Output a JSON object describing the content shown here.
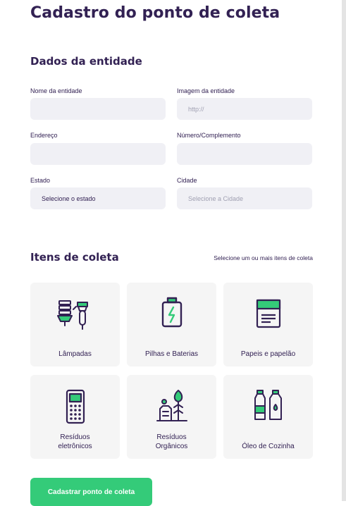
{
  "page": {
    "title": "Cadastro do ponto de coleta"
  },
  "entity_section": {
    "title": "Dados da entidade",
    "fields": {
      "name": {
        "label": "Nome da entidade",
        "value": "",
        "placeholder": ""
      },
      "image": {
        "label": "Imagem da entidade",
        "value": "",
        "placeholder": "http://"
      },
      "address": {
        "label": "Endereço",
        "value": "",
        "placeholder": ""
      },
      "number": {
        "label": "Número/Complemento",
        "value": "",
        "placeholder": ""
      },
      "state": {
        "label": "Estado",
        "selected": "Selecione o estado"
      },
      "city": {
        "label": "Cidade",
        "selected": "Selecione a Cidade"
      }
    }
  },
  "items_section": {
    "title": "Itens de coleta",
    "hint": "Selecione um ou mais itens de coleta",
    "items": [
      {
        "label": "Lâmpadas",
        "icon": "lamps-icon"
      },
      {
        "label": "Pilhas e Baterias",
        "icon": "battery-icon"
      },
      {
        "label": "Papeis e papelão",
        "icon": "paper-icon"
      },
      {
        "label": "Resíduos eletrônicos",
        "icon": "electronics-icon"
      },
      {
        "label": "Resíduos Orgânicos",
        "icon": "organic-waste-icon"
      },
      {
        "label": "Óleo de Cozinha",
        "icon": "cooking-oil-icon"
      }
    ]
  },
  "submit": {
    "label": "Cadastrar ponto de coleta"
  },
  "colors": {
    "primary": "#322153",
    "accent": "#34cb79",
    "field_bg": "#f0f0f5",
    "card_bg": "#f5f5f5"
  }
}
